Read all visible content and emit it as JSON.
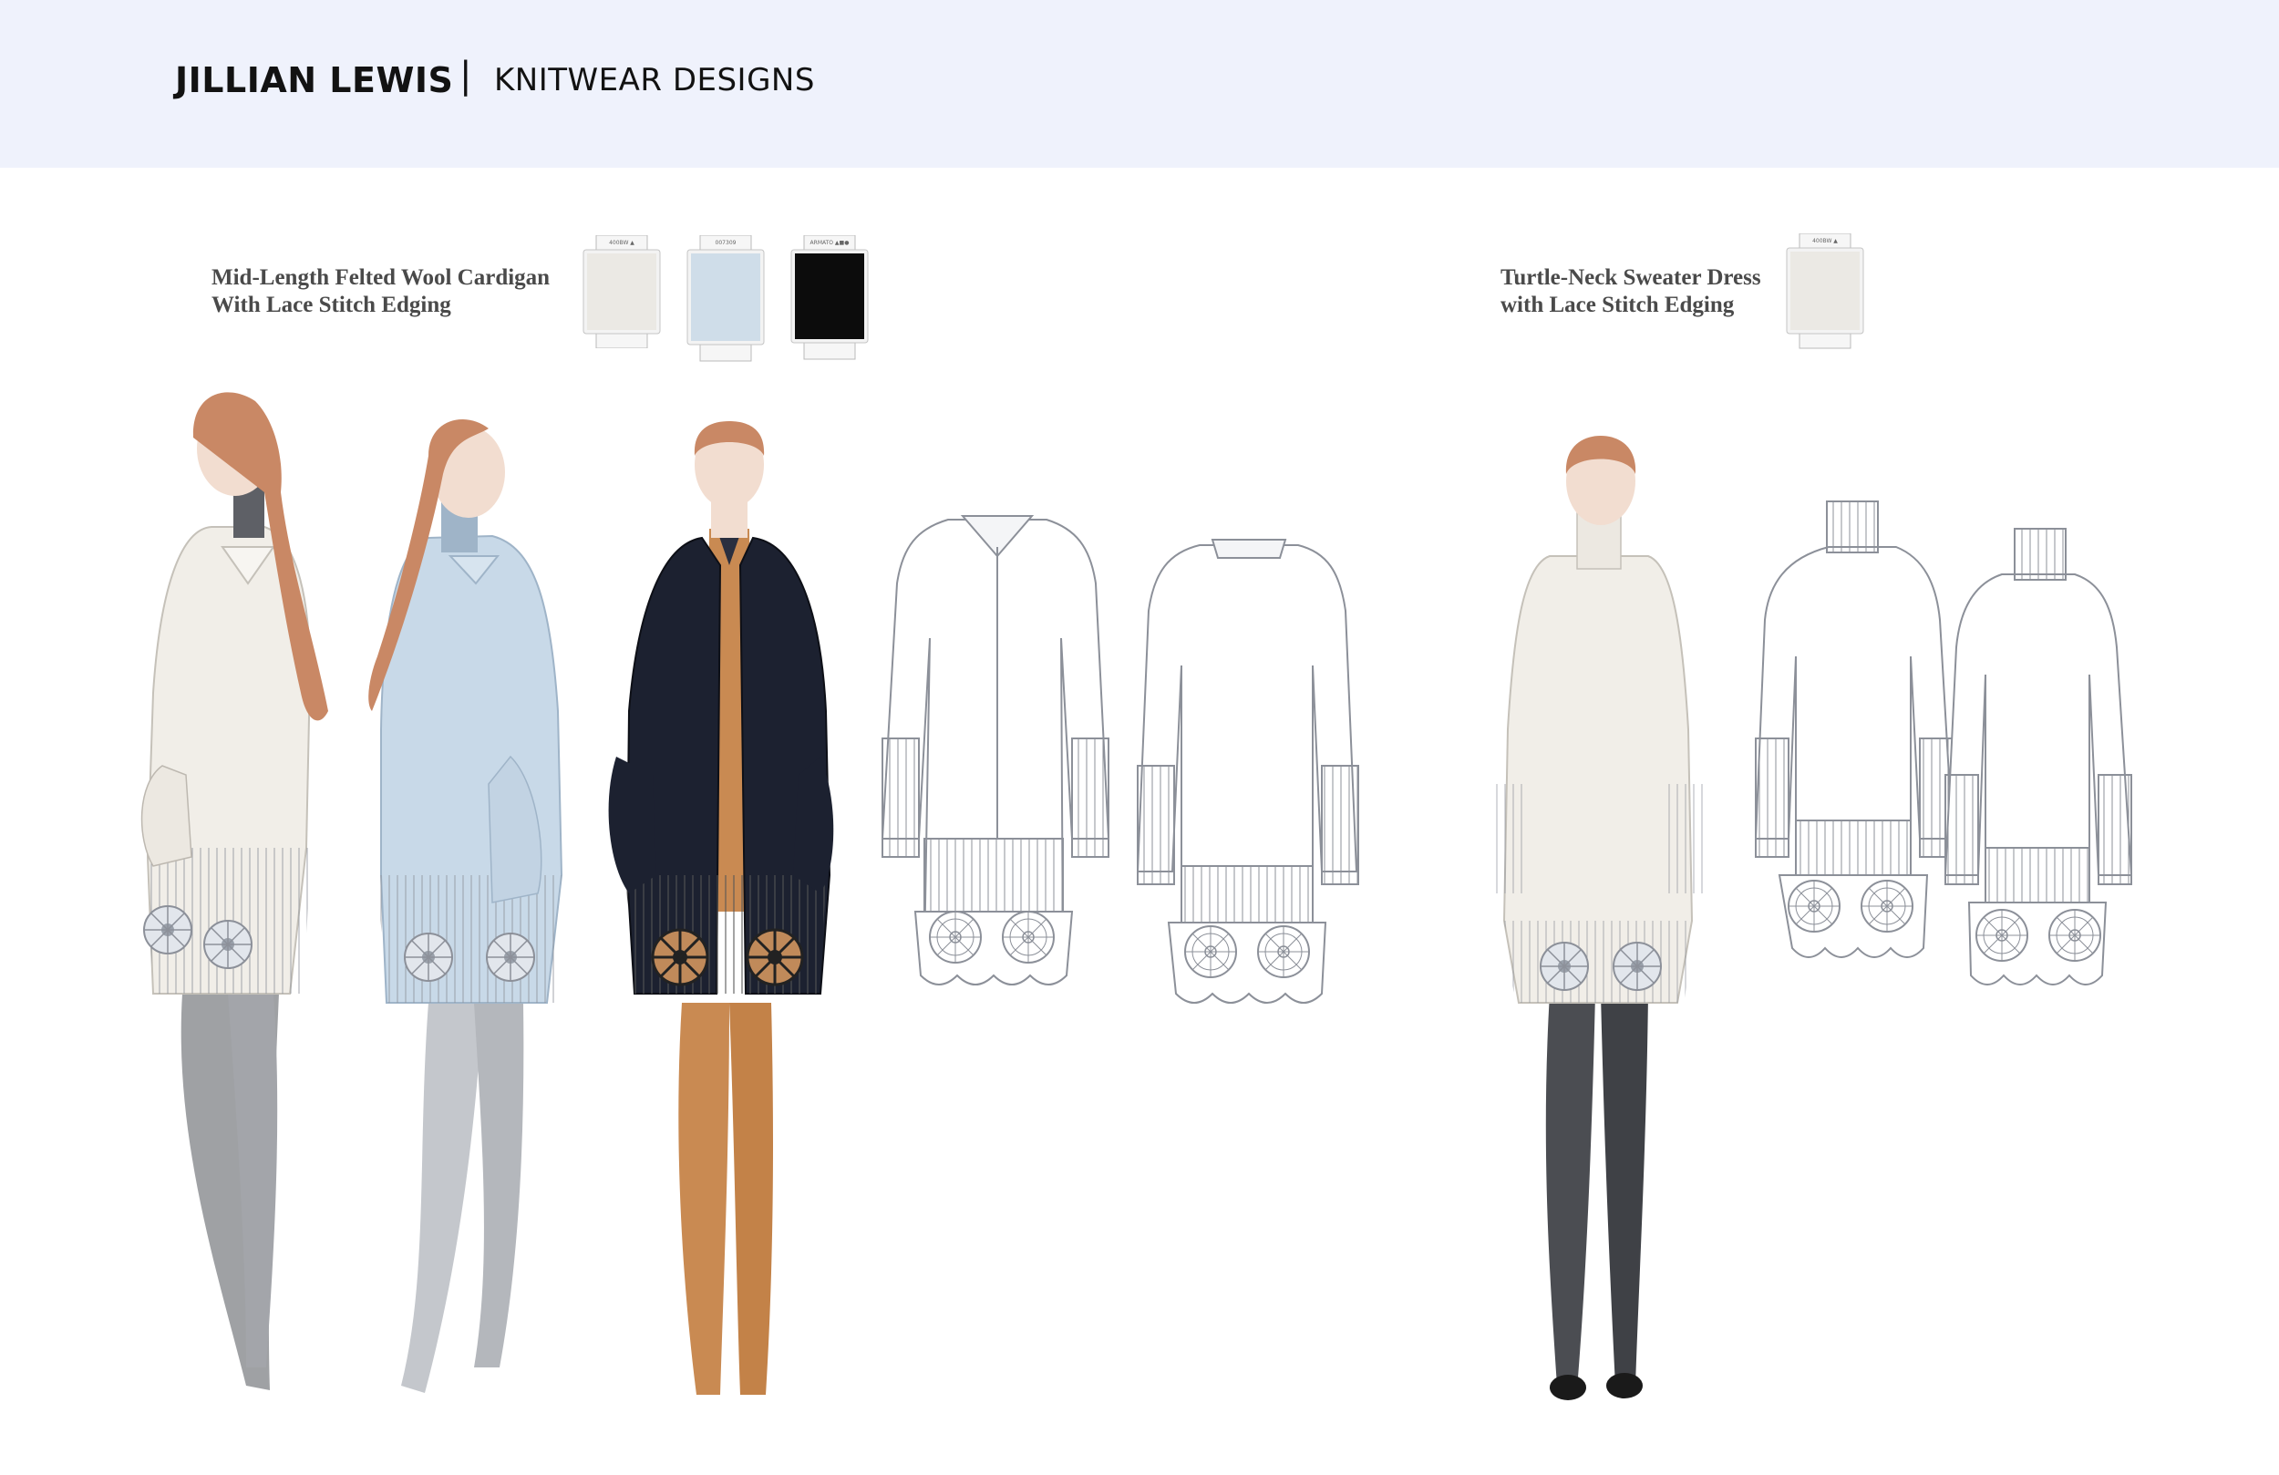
{
  "header": {
    "brand": "JILLIAN LEWIS",
    "separator": "|",
    "subtitle": "KNITWEAR DESIGNS",
    "background": "#eff2fc"
  },
  "designs": [
    {
      "title_line1": "Mid-Length Felted Wool Cardigan",
      "title_line2": "With Lace Stitch Edging",
      "swatches": [
        {
          "color": "#ebe9e4",
          "label": "400BW ▲"
        },
        {
          "color": "#cfdde9",
          "label": "007309"
        },
        {
          "color": "#0c0c0c",
          "label": "ARMATO ▲■●"
        }
      ]
    },
    {
      "title_line1": "Turtle-Neck Sweater Dress",
      "title_line2": "with Lace Stitch Edging",
      "swatches": [
        {
          "color": "#ebe9e4",
          "label": "400BW ▲"
        }
      ]
    }
  ],
  "illustration_colors": {
    "cream": "#f1eee8",
    "light_blue": "#c8d9e8",
    "black": "#1c2130",
    "camel": "#c98a52",
    "grey_leg": "#8e9094",
    "dark_leg": "#4b4d52",
    "hair": "#c98865",
    "skin": "#f2ddd0",
    "flat_stroke": "#8c9099"
  }
}
